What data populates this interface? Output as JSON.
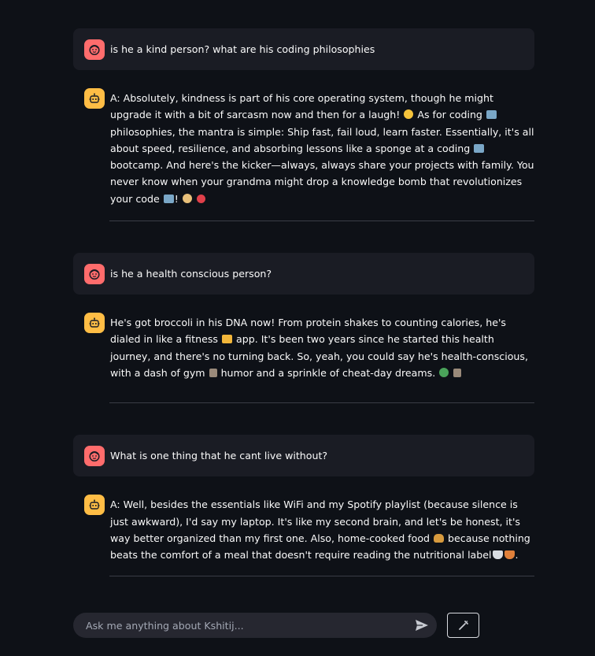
{
  "colors": {
    "background": "#0e1117",
    "user_avatar": "#ff6c6c",
    "bot_avatar": "#ffbd45",
    "user_bubble": "#1a1c24",
    "input_bg": "#262730"
  },
  "messages": [
    {
      "role": "user",
      "avatar_icon": "user-face-icon",
      "text": "is he a kind person? what are his coding philosophies"
    },
    {
      "role": "assistant",
      "avatar_icon": "robot-icon",
      "parts": [
        "A: Absolutely, kindness is part of his core operating system, though he might upgrade it with a bit of sarcasm now and then for a laugh! ",
        " As for coding ",
        " philosophies, the mantra is simple: Ship fast, fail loud, learn faster. Essentially, it's all about speed, resilience, and absorbing lessons like a sponge at a coding ",
        " bootcamp. And here's the kicker—always, always share your projects with family. You never know when your grandma might drop a knowledge bomb that revolutionizes your code ",
        "! ",
        " "
      ],
      "emojis": [
        "grinning-face-emoji",
        "laptop-emoji",
        "laptop-emoji",
        "laptop-emoji",
        "grandma-emoji",
        "explosion-emoji"
      ]
    },
    {
      "role": "user",
      "avatar_icon": "user-face-icon",
      "text": "is he a health conscious person?"
    },
    {
      "role": "assistant",
      "avatar_icon": "robot-icon",
      "parts": [
        "He's got broccoli in his DNA now! From protein shakes to counting calories, he's dialed in like a fitness ",
        " app. It's been two years since he started this health journey, and there's no turning back. So, yeah, you could say he's health-conscious, with a dash of gym ",
        " humor and a sprinkle of cheat-day dreams. ",
        " "
      ],
      "emojis": [
        "flexed-biceps-emoji",
        "weightlifter-emoji",
        "broccoli-emoji",
        "weightlifter-emoji"
      ]
    },
    {
      "role": "user",
      "avatar_icon": "user-face-icon",
      "text": "What is one thing that he cant live without?"
    },
    {
      "role": "assistant",
      "avatar_icon": "robot-icon",
      "parts": [
        "A: Well, besides the essentials like WiFi and my Spotify playlist (because silence is just awkward), I'd say my laptop. It's like my second brain, and let's be honest, it's way better organized than my first one. Also, home-cooked food ",
        " because nothing beats the comfort of a meal that doesn't require reading the nutritional label",
        "."
      ],
      "emojis": [
        "burger-emoji",
        "bowl-emoji"
      ]
    }
  ],
  "input": {
    "placeholder": "Ask me anything about Kshitij...",
    "value": "",
    "send_icon": "send-arrow-icon"
  },
  "tool_button": {
    "icon": "magic-wand-icon"
  }
}
